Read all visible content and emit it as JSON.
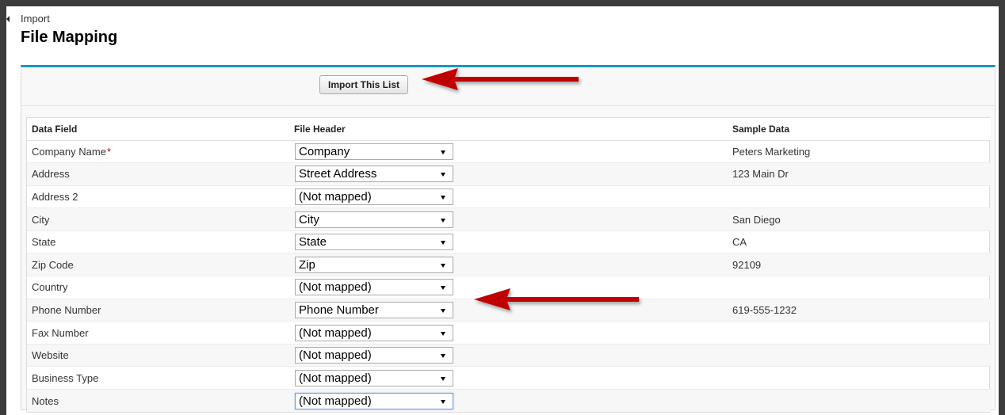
{
  "header": {
    "breadcrumb": "Import",
    "title": "File Mapping"
  },
  "toolbar": {
    "import_label": "Import This List"
  },
  "table": {
    "columns": [
      "Data Field",
      "File Header",
      "Sample Data"
    ],
    "rows": [
      {
        "field": "Company Name",
        "required": "*",
        "header": "Company",
        "sample": "Peters Marketing"
      },
      {
        "field": "Address",
        "header": "Street Address",
        "sample": "123 Main Dr"
      },
      {
        "field": "Address 2",
        "header": "(Not mapped)",
        "sample": ""
      },
      {
        "field": "City",
        "header": "City",
        "sample": "San Diego"
      },
      {
        "field": "State",
        "header": "State",
        "sample": "CA"
      },
      {
        "field": "Zip Code",
        "header": "Zip",
        "sample": "92109"
      },
      {
        "field": "Country",
        "header": "(Not mapped)",
        "sample": ""
      },
      {
        "field": "Phone Number",
        "header": "Phone Number",
        "sample": "619-555-1232"
      },
      {
        "field": "Fax Number",
        "header": "(Not mapped)",
        "sample": ""
      },
      {
        "field": "Website",
        "header": "(Not mapped)",
        "sample": ""
      },
      {
        "field": "Business Type",
        "header": "(Not mapped)",
        "sample": ""
      },
      {
        "field": "Notes",
        "header": "(Not mapped)",
        "sample": ""
      }
    ]
  },
  "colors": {
    "accent": "#1797c0",
    "annotation_arrow": "#c00000",
    "required": "#cc0000"
  }
}
